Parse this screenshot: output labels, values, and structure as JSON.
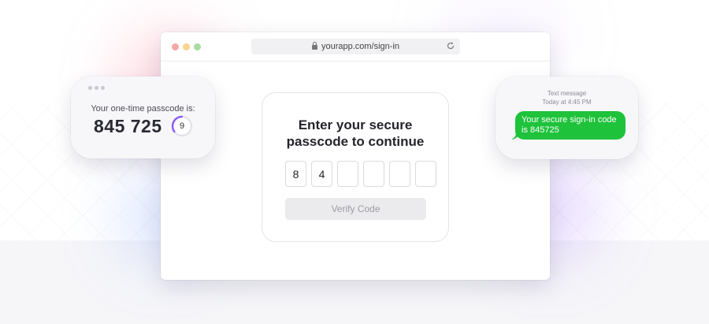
{
  "browser": {
    "url": "yourapp.com/sign-in"
  },
  "signin_card": {
    "title": "Enter your secure\npasscode to continue",
    "digits": [
      "8",
      "4",
      "",
      "",
      "",
      ""
    ],
    "verify_label": "Verify Code"
  },
  "passcode_card": {
    "label": "Your one-time passcode is:",
    "code": "845 725",
    "timer": "9"
  },
  "sms_card": {
    "heading": "Text message",
    "time": "Today at 4:45 PM",
    "message": "Your secure sign-in code\nis 845725"
  },
  "colors": {
    "sms_bubble": "#1fc23b",
    "timer_ring": "#8a5cf6"
  },
  "icons": [
    "lock-icon",
    "reload-icon",
    "timer-ring-icon"
  ]
}
